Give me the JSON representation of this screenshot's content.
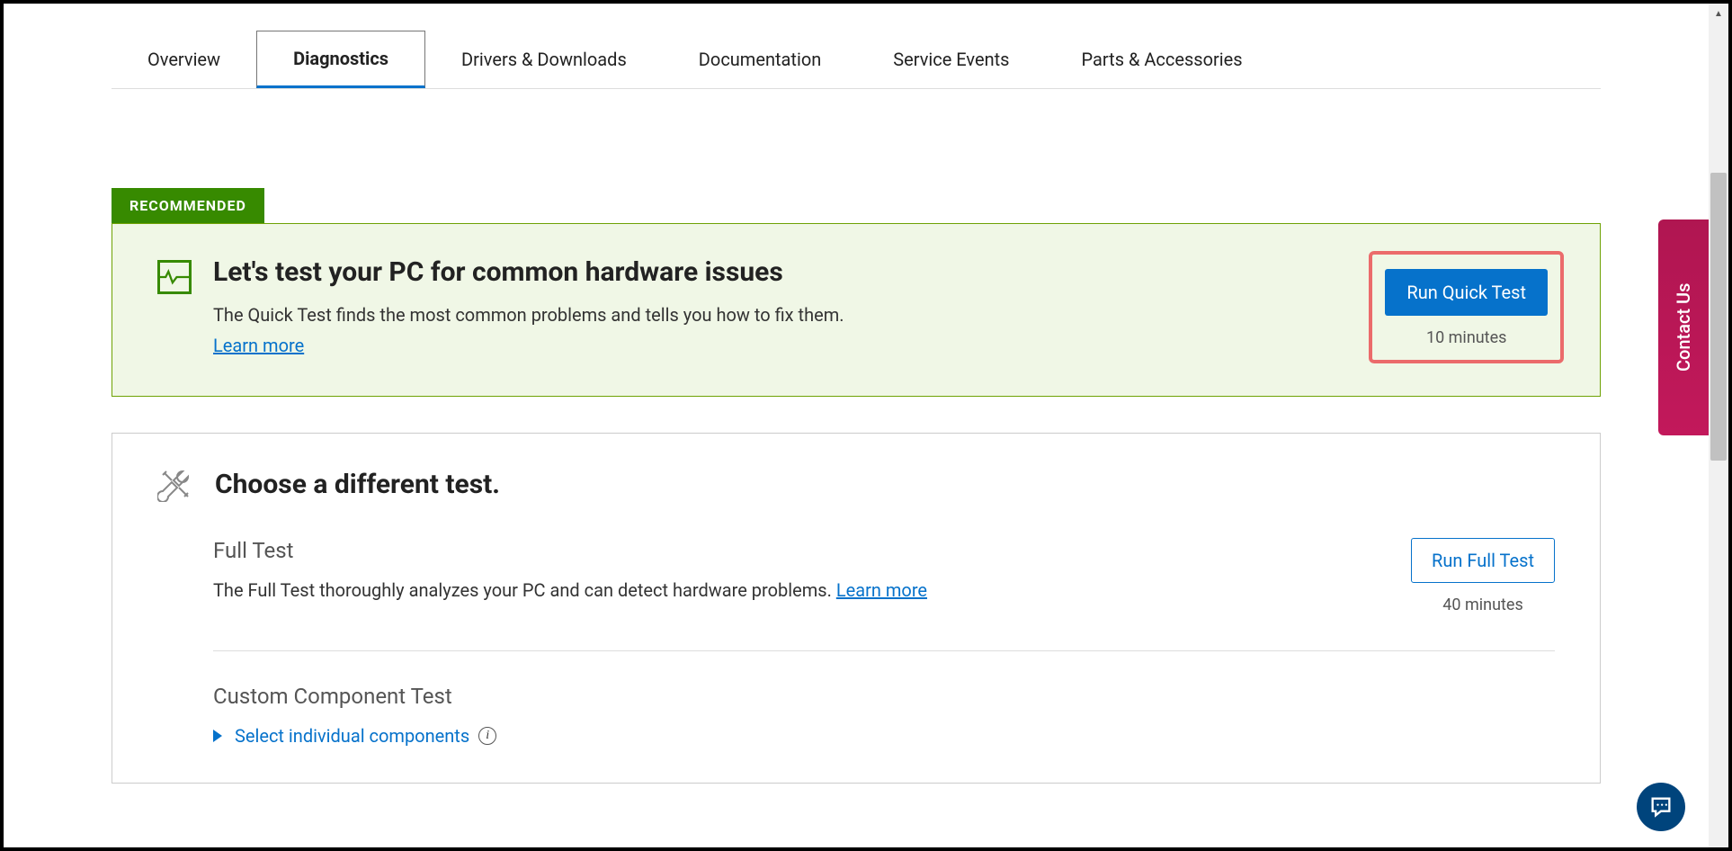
{
  "tabs": {
    "overview": "Overview",
    "diagnostics": "Diagnostics",
    "drivers": "Drivers & Downloads",
    "documentation": "Documentation",
    "service_events": "Service Events",
    "parts": "Parts & Accessories"
  },
  "recommended": {
    "badge": "RECOMMENDED",
    "title": "Let's test your PC for common hardware issues",
    "description": "The Quick Test finds the most common problems and tells you how to fix them.",
    "learn_more": "Learn more",
    "button": "Run Quick Test",
    "duration": "10 minutes"
  },
  "different_test": {
    "title": "Choose a different test.",
    "full": {
      "title": "Full Test",
      "description": "The Full Test thoroughly analyzes your PC and can detect hardware problems. ",
      "learn_more": "Learn more",
      "button": "Run Full Test",
      "duration": "40 minutes"
    },
    "custom": {
      "title": "Custom Component Test",
      "expand": "Select individual components"
    }
  },
  "contact_us": "Contact Us"
}
